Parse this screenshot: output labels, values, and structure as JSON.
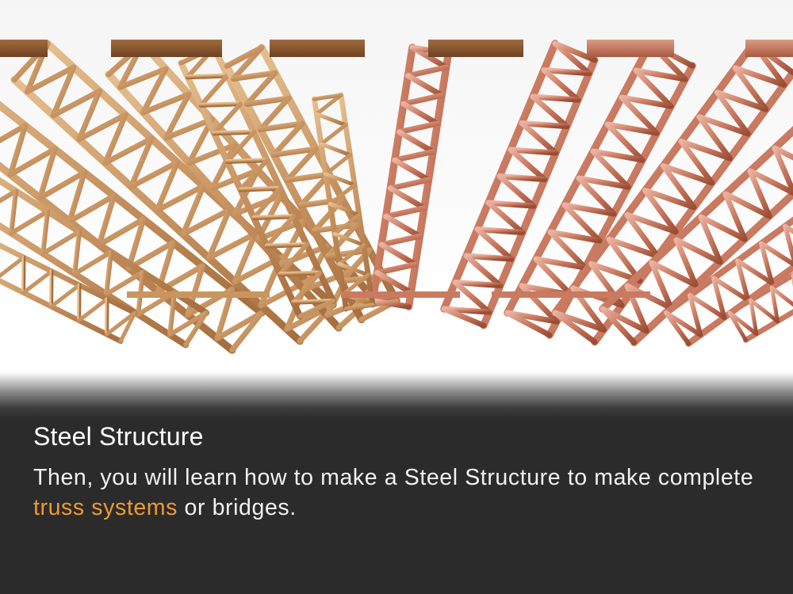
{
  "image": {
    "alt": "Steel Structure",
    "colors": {
      "wood_light": "#d9ae7c",
      "wood_dark": "#8e5a30",
      "beam_wood": "#86562e",
      "copper_light": "#e3a18c",
      "copper_dark": "#a85a40",
      "beam_copper": "#c47a62"
    }
  },
  "caption": {
    "title": "Steel Structure",
    "body_before": "Then, you will learn how to make a Steel Structure to make complete ",
    "highlight": "truss systems",
    "body_after": " or bridges.",
    "highlight_color": "#ef9a2e",
    "background": "#2b2b2b"
  }
}
